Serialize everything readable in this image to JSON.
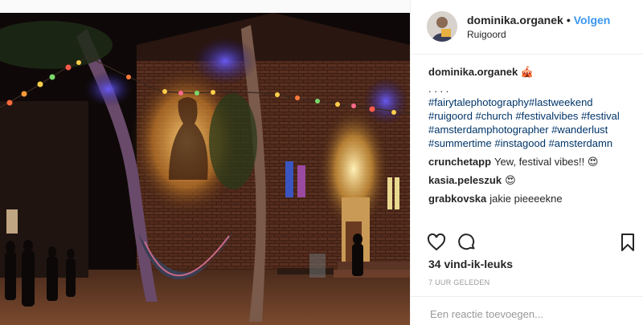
{
  "post": {
    "username": "dominika.organek",
    "follow_label": "Volgen",
    "separator": "•",
    "location": "Ruigoord",
    "caption": {
      "username": "dominika.organek",
      "emoji": "🎪",
      "dots": ". . . .",
      "hashtags": "#fairytalephotography#lastweekend #ruigoord #church #festivalvibes #festival #amsterdamphotographer #wanderlust #summertime #instagood #amsterdamn"
    },
    "comments": [
      {
        "user": "crunchetapp",
        "text": "Yew, festival vibes!! 😍"
      },
      {
        "user": "kasia.peleszuk",
        "text": "😍"
      },
      {
        "user": "grabkovska",
        "text": "jakie pieeeekne"
      }
    ],
    "likes": "34 vind-ik-leuks",
    "time_ago": "7 UUR GELEDEN",
    "comment_placeholder": "Een reactie toevoegen..."
  },
  "icons": {
    "like": "heart-icon",
    "comment": "comment-icon",
    "save": "bookmark-icon"
  },
  "colors": {
    "link": "#3897f0",
    "hashtag": "#003569",
    "muted": "#999999"
  }
}
